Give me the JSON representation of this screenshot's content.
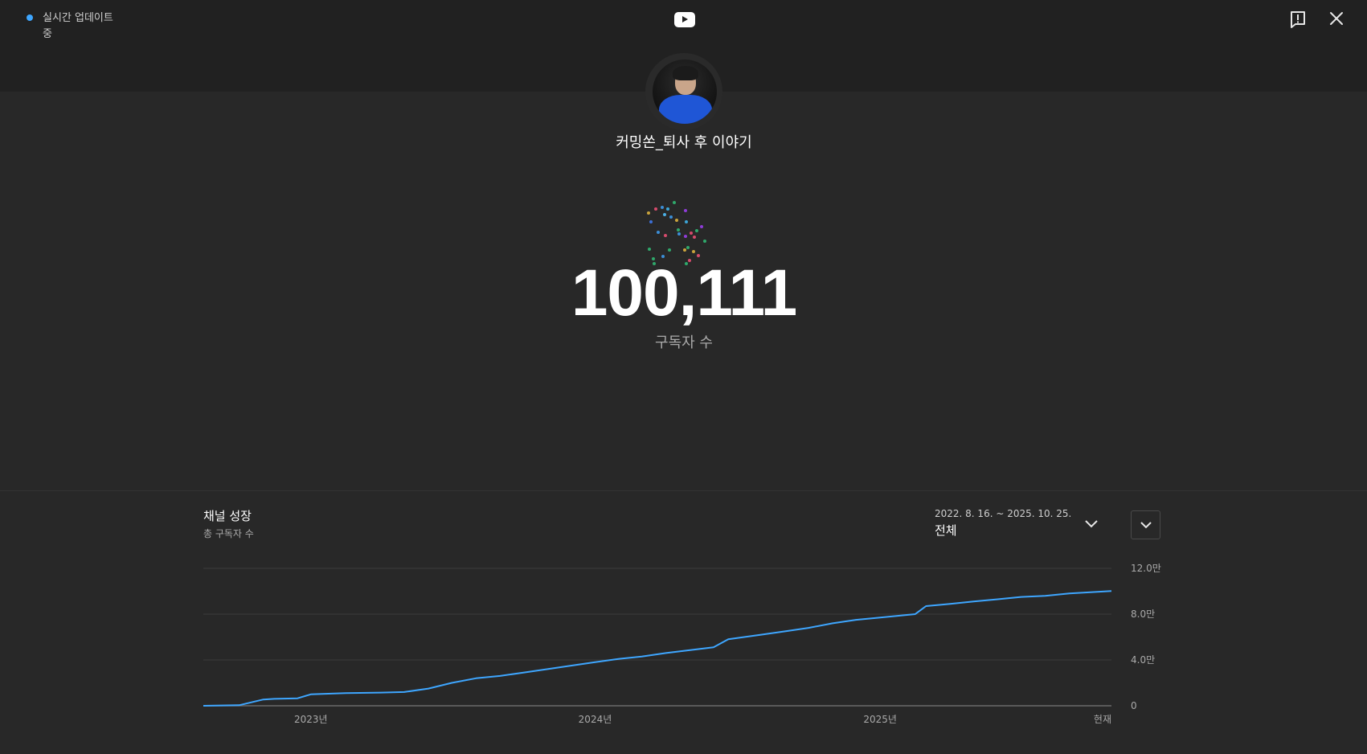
{
  "header": {
    "live_status": "실시간 업데이트 중",
    "logo_icon": "youtube-logo-icon",
    "feedback_icon": "feedback-icon",
    "close_icon": "close-icon",
    "live_color": "#3ea6ff"
  },
  "channel": {
    "name": "커밍쏜_퇴사 후 이야기",
    "subscriber_count": "100,111",
    "subscriber_label": "구독자 수"
  },
  "growth": {
    "title": "채널 성장",
    "subtitle": "총 구독자 수",
    "range_dates": "2022. 8. 16. ~ 2025. 10. 25.",
    "range_label": "전체"
  },
  "chart_data": {
    "type": "line",
    "title": "채널 성장",
    "subtitle": "총 구독자 수",
    "x_tick_labels": [
      "2023년",
      "2024년",
      "2025년",
      "현재"
    ],
    "x_tick_dates": [
      "2023-01-01",
      "2024-01-01",
      "2025-01-01",
      "2025-10-25"
    ],
    "y_tick_labels": [
      "0",
      "4.0만",
      "8.0만",
      "12.0만"
    ],
    "y_tick_values": [
      0,
      40000,
      80000,
      120000
    ],
    "ylim": [
      0,
      120000
    ],
    "xlim": [
      "2022-08-16",
      "2025-10-25"
    ],
    "grid": true,
    "line_color": "#3ea6ff",
    "series": [
      {
        "x": [
          "2022-08-16",
          "2022-10-01",
          "2022-11-01",
          "2022-11-15",
          "2022-12-15",
          "2023-01-01",
          "2023-02-15",
          "2023-04-01",
          "2023-05-01",
          "2023-06-01",
          "2023-07-01",
          "2023-08-01",
          "2023-09-01",
          "2023-10-01",
          "2023-11-01",
          "2023-12-01",
          "2024-01-01",
          "2024-02-01",
          "2024-03-01",
          "2024-04-01",
          "2024-05-01",
          "2024-06-01",
          "2024-06-20",
          "2024-08-01",
          "2024-09-01",
          "2024-10-01",
          "2024-11-01",
          "2024-12-01",
          "2025-01-01",
          "2025-02-15",
          "2025-03-01",
          "2025-04-01",
          "2025-05-01",
          "2025-06-01",
          "2025-07-01",
          "2025-08-01",
          "2025-09-01",
          "2025-10-25"
        ],
        "y": [
          0,
          500,
          5500,
          6000,
          6500,
          10000,
          11000,
          11500,
          12000,
          15000,
          20000,
          24000,
          26000,
          29000,
          32000,
          35000,
          38000,
          41000,
          43000,
          46000,
          48500,
          51000,
          58000,
          62000,
          65000,
          68000,
          72000,
          75000,
          77000,
          80000,
          87000,
          89000,
          91000,
          93000,
          95000,
          96000,
          98000,
          100111
        ]
      }
    ]
  }
}
